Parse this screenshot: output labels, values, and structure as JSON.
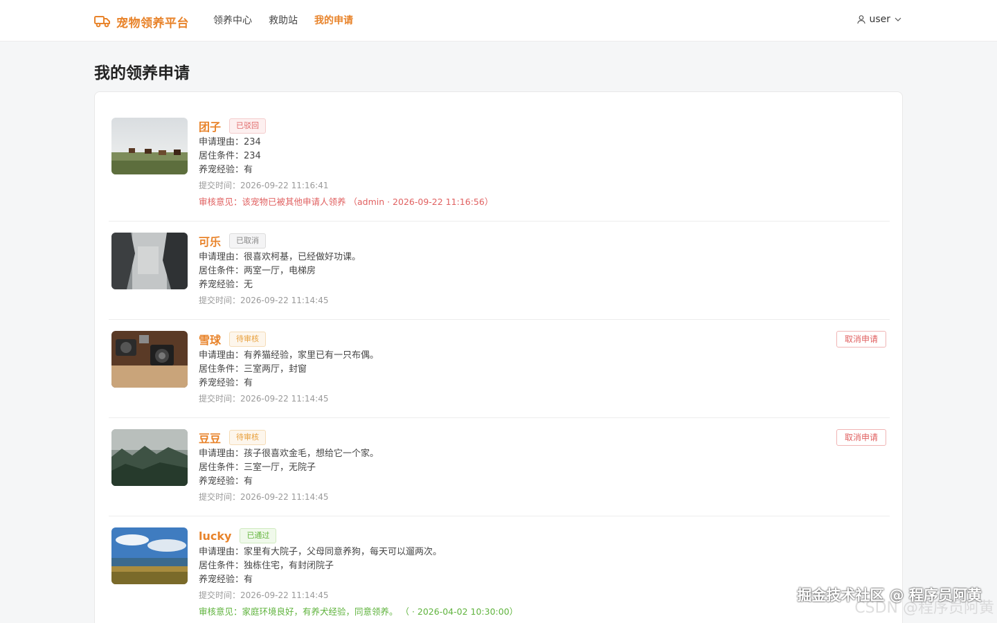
{
  "header": {
    "brand": "宠物领养平台",
    "nav": [
      "领养中心",
      "救助站",
      "我的申请"
    ],
    "user": "user"
  },
  "page": {
    "title": "我的领养申请"
  },
  "labels": {
    "reason": "申请理由：",
    "housing": "居住条件：",
    "experience": "养宠经验：",
    "time": "提交时间：",
    "review": "审核意见："
  },
  "applications": [
    {
      "name": "团子",
      "status": "已驳回",
      "reason": "234",
      "housing": "234",
      "experience": "有",
      "time": "2026-09-22 11:16:41",
      "review": "审核意见：该宠物已被其他申请人领养 （admin · 2026-09-22 11:16:56）"
    },
    {
      "name": "可乐",
      "status": "已取消",
      "reason": "很喜欢柯基，已经做好功课。",
      "housing": "两室一厅，电梯房",
      "experience": "无",
      "time": "2026-09-22 11:14:45"
    },
    {
      "name": "雪球",
      "status": "待审核",
      "reason": "有养猫经验，家里已有一只布偶。",
      "housing": "三室两厅，封窗",
      "experience": "有",
      "time": "2026-09-22 11:14:45",
      "action": "取消申请"
    },
    {
      "name": "豆豆",
      "status": "待审核",
      "reason": "孩子很喜欢金毛，想给它一个家。",
      "housing": "三室一厅，无院子",
      "experience": "有",
      "time": "2026-09-22 11:14:45",
      "action": "取消申请"
    },
    {
      "name": "lucky",
      "status": "已通过",
      "reason": "家里有大院子，父母同意养狗，每天可以遛两次。",
      "housing": "独栋住宅，有封闭院子",
      "experience": "有",
      "time": "2026-09-22 11:14:45",
      "review": "审核意见：家庭环境良好，有养犬经验，同意领养。 （ · 2026-04-02 10:30:00）"
    }
  ],
  "watermark": "掘金技术社区 @ 程序员阿黄",
  "watermark2": "CSDN @程序员阿黄",
  "colors": {
    "accent": "#e8832a",
    "danger": "#e06060",
    "success": "#5fb33d",
    "warning": "#e8a03c"
  }
}
